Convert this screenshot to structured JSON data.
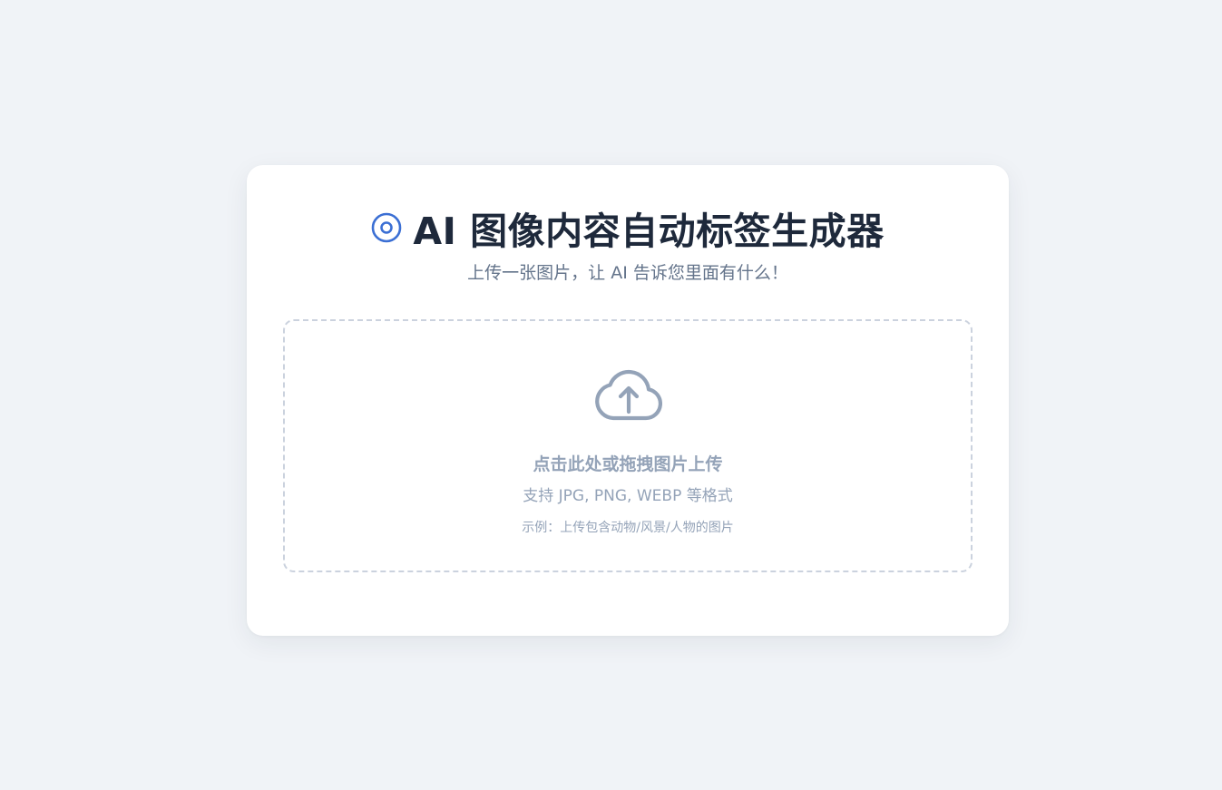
{
  "header": {
    "icon": "target-icon",
    "title": "AI 图像内容自动标签生成器",
    "subtitle": "上传一张图片，让 AI 告诉您里面有什么！"
  },
  "upload": {
    "icon": "cloud-upload-icon",
    "main_label": "点击此处或拖拽图片上传",
    "formats": "支持 JPG, PNG, WEBP 等格式",
    "example": "示例：上传包含动物/风景/人物的图片"
  },
  "colors": {
    "background": "#f0f3f7",
    "card": "#ffffff",
    "accent": "#3b6fd4",
    "title": "#1e293b",
    "muted": "#94a3b8",
    "subtitle": "#64748b",
    "dropzone_border": "#cbd2de"
  }
}
